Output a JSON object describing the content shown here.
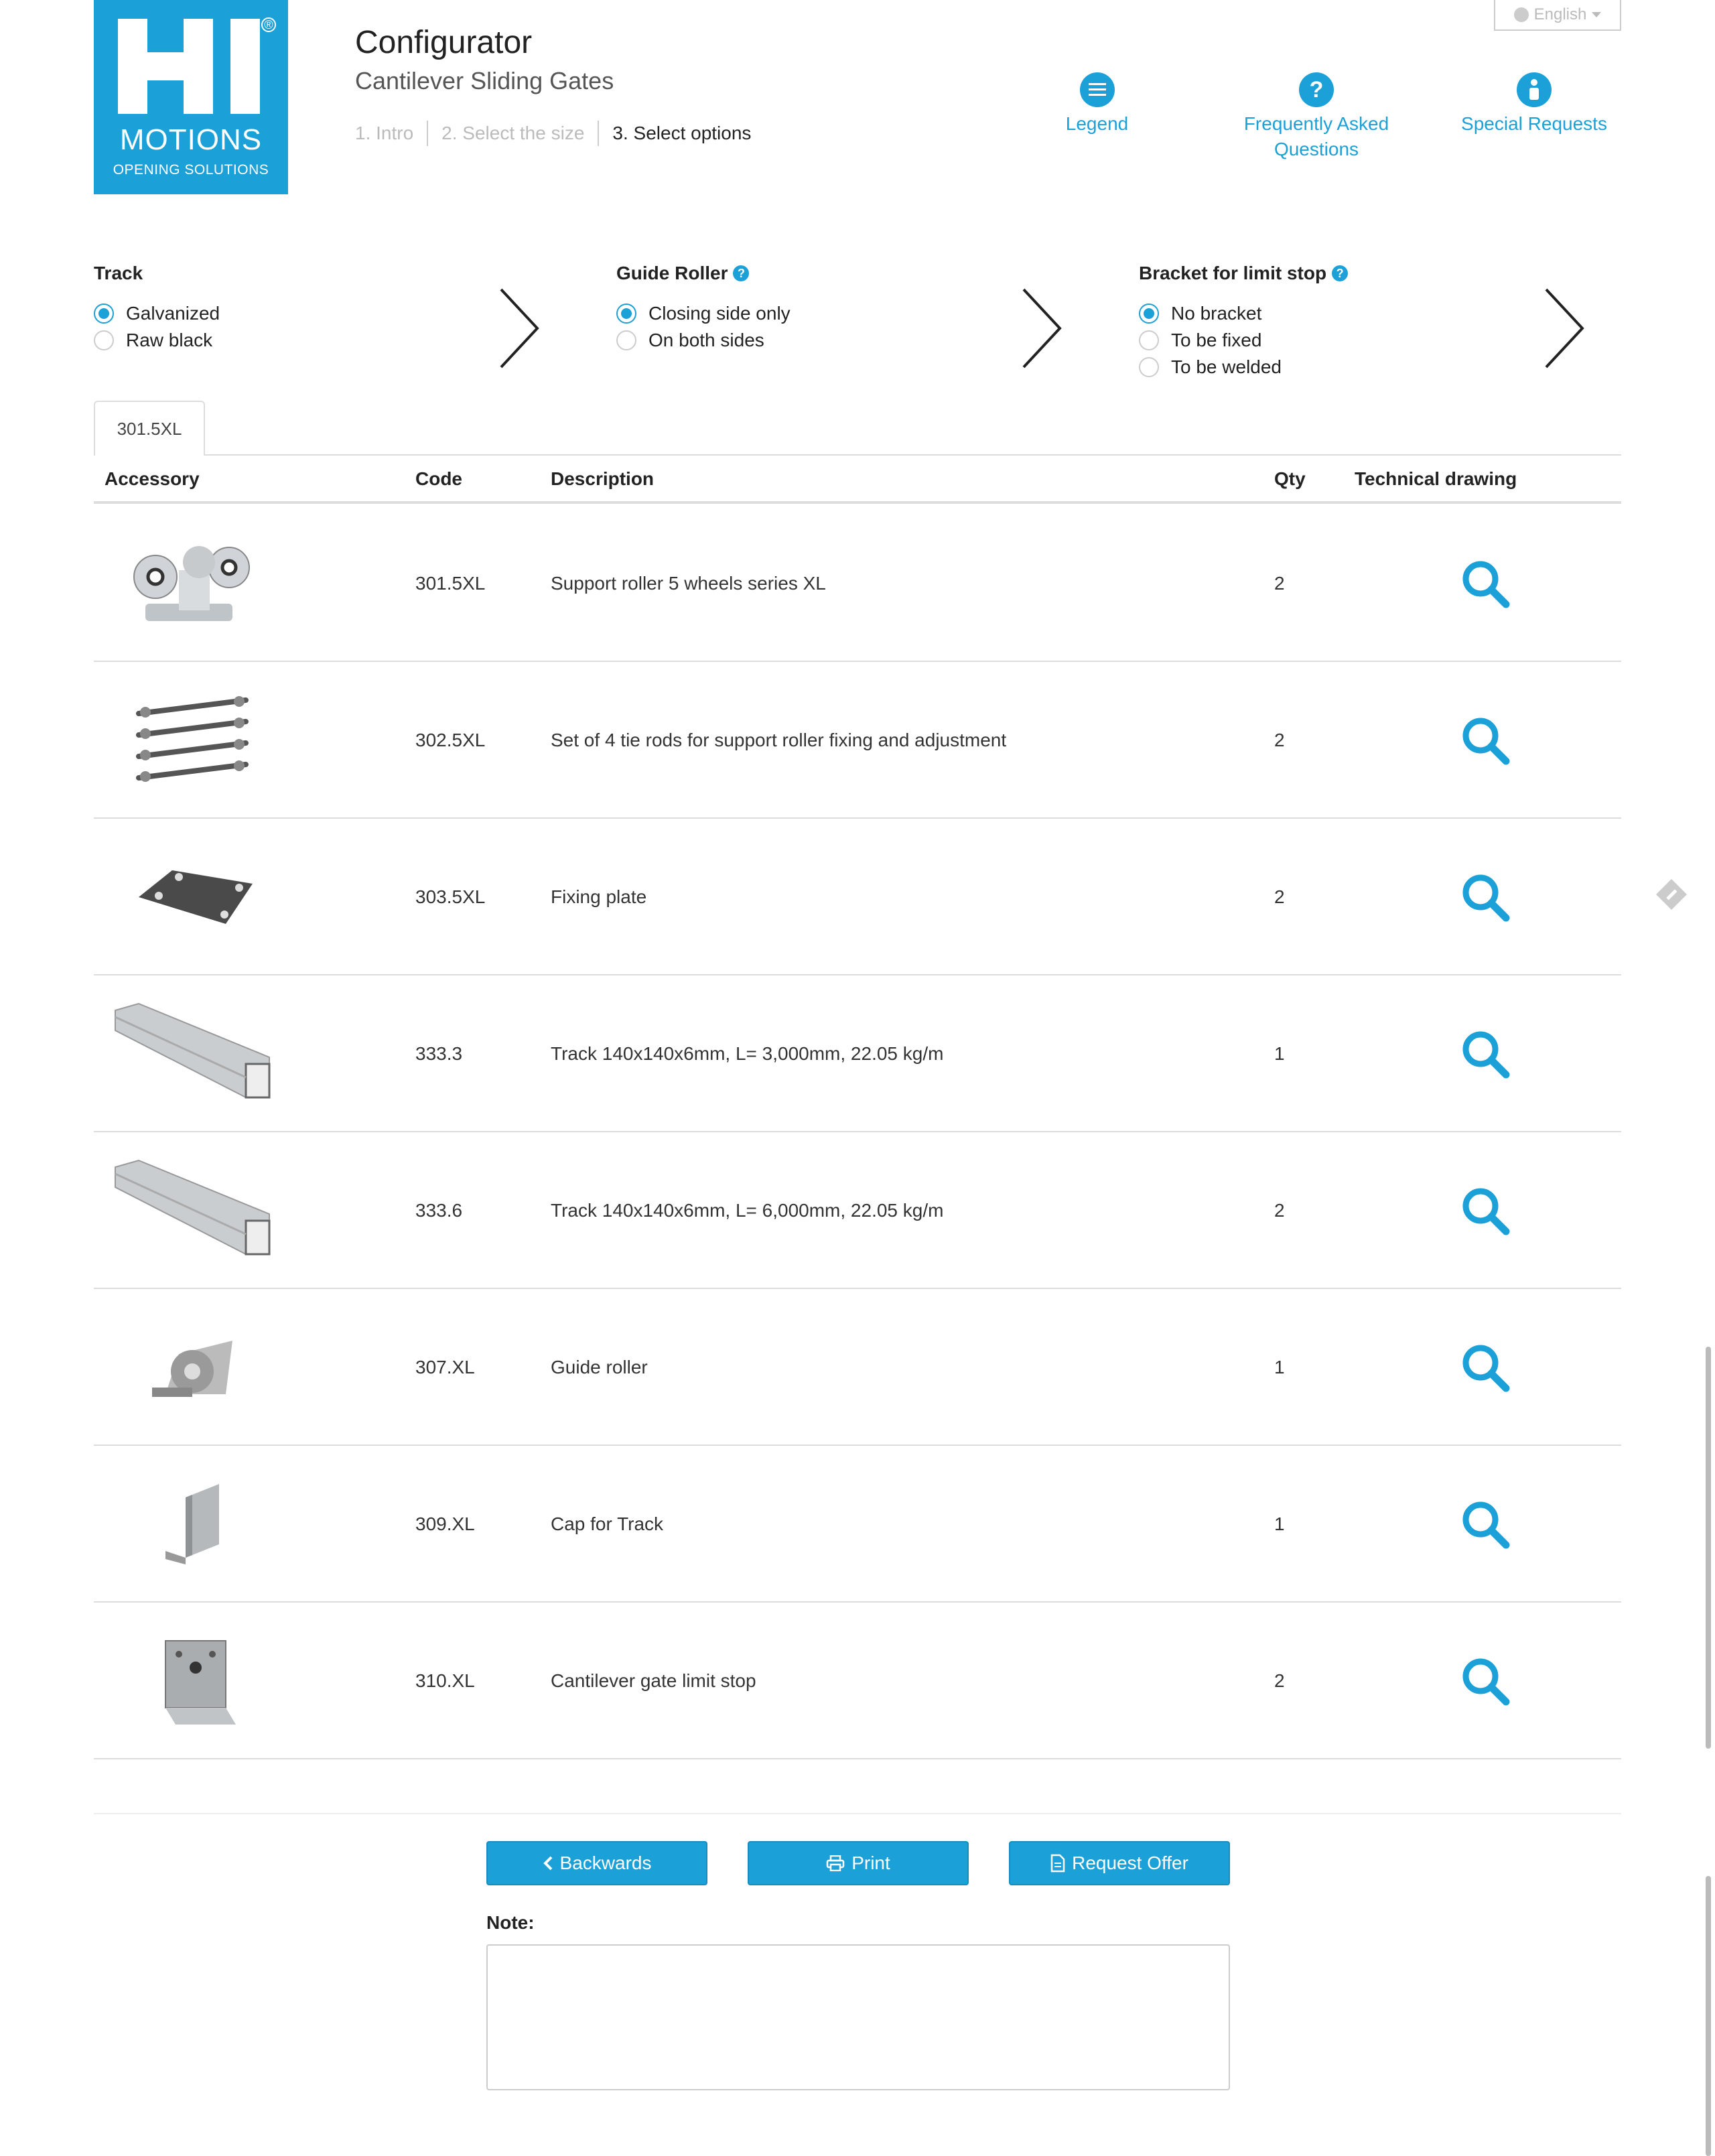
{
  "logo": {
    "letters": "HI",
    "registered": "®",
    "motions": "MOTIONS",
    "tagline": "OPENING SOLUTIONS"
  },
  "header": {
    "title": "Configurator",
    "subtitle": "Cantilever Sliding Gates",
    "steps": [
      "1. Intro",
      "2. Select the size",
      "3. Select options"
    ]
  },
  "language": "English",
  "nav": {
    "legend": "Legend",
    "faq_line1": "Frequently Asked",
    "faq_line2": "Questions",
    "special": "Special Requests"
  },
  "options": {
    "track": {
      "title": "Track",
      "items": [
        "Galvanized",
        "Raw black"
      ],
      "selected": 0
    },
    "guide_roller": {
      "title": "Guide Roller",
      "items": [
        "Closing side only",
        "On both sides"
      ],
      "selected": 0
    },
    "bracket": {
      "title": "Bracket for limit stop",
      "items": [
        "No bracket",
        "To be fixed",
        "To be welded"
      ],
      "selected": 0
    }
  },
  "tab": "301.5XL",
  "table": {
    "headers": [
      "Accessory",
      "Code",
      "Description",
      "Qty",
      "Technical drawing"
    ],
    "rows": [
      {
        "code": "301.5XL",
        "description": "Support roller 5 wheels series XL",
        "qty": "2"
      },
      {
        "code": "302.5XL",
        "description": "Set of 4 tie rods for support roller fixing and adjustment",
        "qty": "2"
      },
      {
        "code": "303.5XL",
        "description": "Fixing plate",
        "qty": "2"
      },
      {
        "code": "333.3",
        "description": "Track 140x140x6mm, L= 3,000mm, 22.05 kg/m",
        "qty": "1"
      },
      {
        "code": "333.6",
        "description": "Track 140x140x6mm, L= 6,000mm, 22.05 kg/m",
        "qty": "2"
      },
      {
        "code": "307.XL",
        "description": "Guide roller",
        "qty": "1"
      },
      {
        "code": "309.XL",
        "description": "Cap for Track",
        "qty": "1"
      },
      {
        "code": "310.XL",
        "description": "Cantilever gate limit stop",
        "qty": "2"
      }
    ]
  },
  "buttons": {
    "backwards": "Backwards",
    "print": "Print",
    "request": "Request Offer"
  },
  "note": {
    "label": "Note:",
    "value": ""
  },
  "colors": {
    "accent": "#1ba0d8"
  }
}
